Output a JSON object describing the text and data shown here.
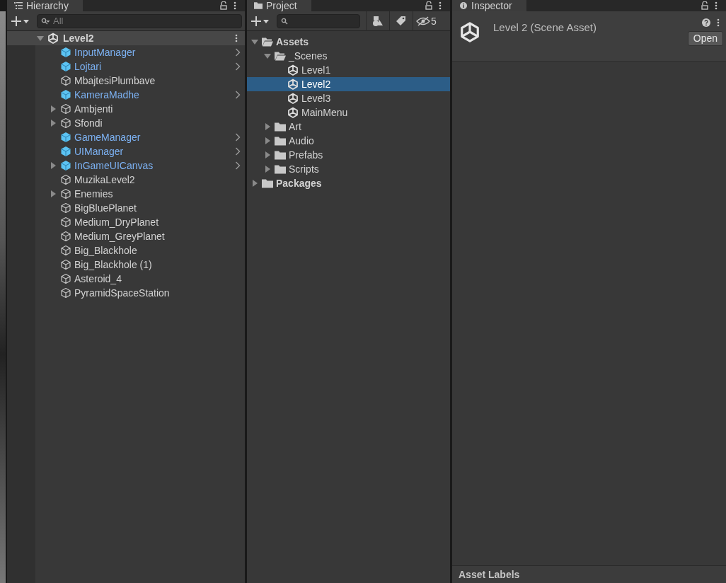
{
  "hierarchy": {
    "tab": {
      "title": "Hierarchy"
    },
    "search": {
      "placeholder": "All"
    },
    "root": {
      "name": "Level2",
      "expanded": true
    },
    "items": [
      {
        "name": "InputManager",
        "kind": "prefab",
        "expandable": false
      },
      {
        "name": "Lojtari",
        "kind": "prefab",
        "expandable": false
      },
      {
        "name": "MbajtesiPlumbave",
        "kind": "object",
        "expandable": false
      },
      {
        "name": "KameraMadhe",
        "kind": "prefab",
        "expandable": false
      },
      {
        "name": "Ambjenti",
        "kind": "object",
        "expandable": true
      },
      {
        "name": "Sfondi",
        "kind": "object",
        "expandable": true
      },
      {
        "name": "GameManager",
        "kind": "prefab",
        "expandable": false
      },
      {
        "name": "UIManager",
        "kind": "prefab",
        "expandable": false
      },
      {
        "name": "InGameUICanvas",
        "kind": "prefab",
        "expandable": true
      },
      {
        "name": "MuzikaLevel2",
        "kind": "object",
        "expandable": false
      },
      {
        "name": "Enemies",
        "kind": "object",
        "expandable": true
      },
      {
        "name": "BigBluePlanet",
        "kind": "object",
        "expandable": false
      },
      {
        "name": "Medium_DryPlanet",
        "kind": "object",
        "expandable": false
      },
      {
        "name": "Medium_GreyPlanet",
        "kind": "object",
        "expandable": false
      },
      {
        "name": "Big_Blackhole",
        "kind": "object",
        "expandable": false
      },
      {
        "name": "Big_Blackhole (1)",
        "kind": "object",
        "expandable": false
      },
      {
        "name": "Asteroid_4",
        "kind": "object",
        "expandable": false
      },
      {
        "name": "PyramidSpaceStation",
        "kind": "object",
        "expandable": false
      }
    ]
  },
  "project": {
    "tab": {
      "title": "Project"
    },
    "hidden_count": "5",
    "tree": [
      {
        "name": "Assets",
        "kind": "folder",
        "expanded": true,
        "selected": false,
        "children": [
          {
            "name": "_Scenes",
            "kind": "folder",
            "expanded": true,
            "selected": false,
            "children": [
              {
                "name": "Level1",
                "kind": "scene",
                "selected": false
              },
              {
                "name": "Level2",
                "kind": "scene",
                "selected": true
              },
              {
                "name": "Level3",
                "kind": "scene",
                "selected": false
              },
              {
                "name": "MainMenu",
                "kind": "scene",
                "selected": false
              }
            ]
          },
          {
            "name": "Art",
            "kind": "folder",
            "expanded": false,
            "selected": false
          },
          {
            "name": "Audio",
            "kind": "folder",
            "expanded": false,
            "selected": false
          },
          {
            "name": "Prefabs",
            "kind": "folder",
            "expanded": false,
            "selected": false
          },
          {
            "name": "Scripts",
            "kind": "folder",
            "expanded": false,
            "selected": false
          }
        ]
      },
      {
        "name": "Packages",
        "kind": "folder",
        "expanded": false,
        "selected": false
      }
    ]
  },
  "inspector": {
    "tab": {
      "title": "Inspector"
    },
    "asset_title": "Level 2 (Scene Asset)",
    "open_button": "Open",
    "footer": "Asset Labels"
  }
}
